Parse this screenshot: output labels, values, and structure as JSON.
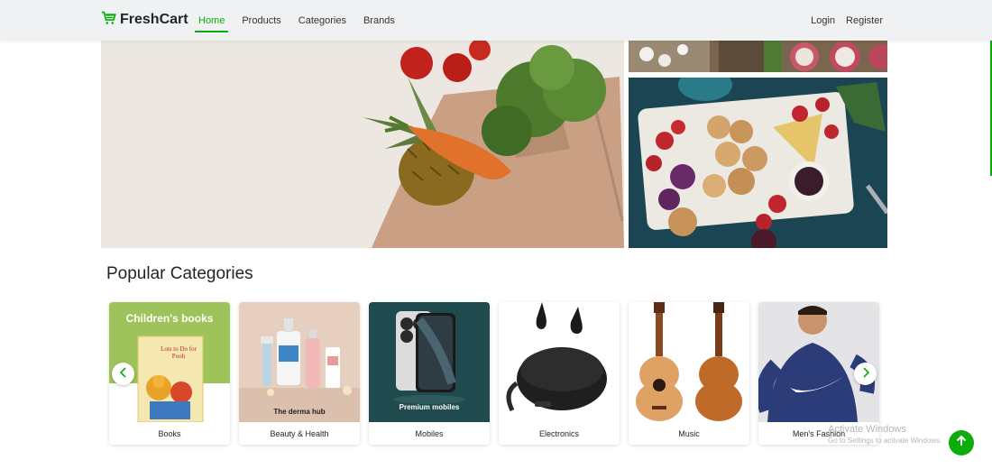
{
  "navbar": {
    "brand": "FreshCart",
    "brand_icon": "cart-icon",
    "links": [
      {
        "label": "Home",
        "active": true
      },
      {
        "label": "Products",
        "active": false
      },
      {
        "label": "Categories",
        "active": false
      },
      {
        "label": "Brands",
        "active": false
      }
    ],
    "auth": {
      "login": "Login",
      "register": "Register"
    }
  },
  "hero": {
    "main_image": "grocery-bag-image",
    "side_images": [
      "flowers-and-radish-image",
      "charcuterie-board-image"
    ]
  },
  "categories": {
    "title": "Popular Categories",
    "items": [
      {
        "label": "Books",
        "overlay": "Children's books",
        "book_title": "Lots to Do for Pooh"
      },
      {
        "label": "Beauty & Health",
        "overlay": "The derma hub"
      },
      {
        "label": "Mobiles",
        "overlay": "Premium mobiles"
      },
      {
        "label": "Electronics",
        "overlay": ""
      },
      {
        "label": "Music",
        "overlay": ""
      },
      {
        "label": "Men's Fashion",
        "overlay": ""
      }
    ],
    "prev_icon": "chevron-left-icon",
    "next_icon": "chevron-right-icon"
  },
  "windows_watermark": {
    "title": "Activate Windows",
    "subtitle": "Go to Settings to activate Windows."
  },
  "scroll_top_icon": "arrow-up-icon",
  "colors": {
    "accent": "#0aad0a",
    "navbar_bg": "#f0f1f3"
  }
}
